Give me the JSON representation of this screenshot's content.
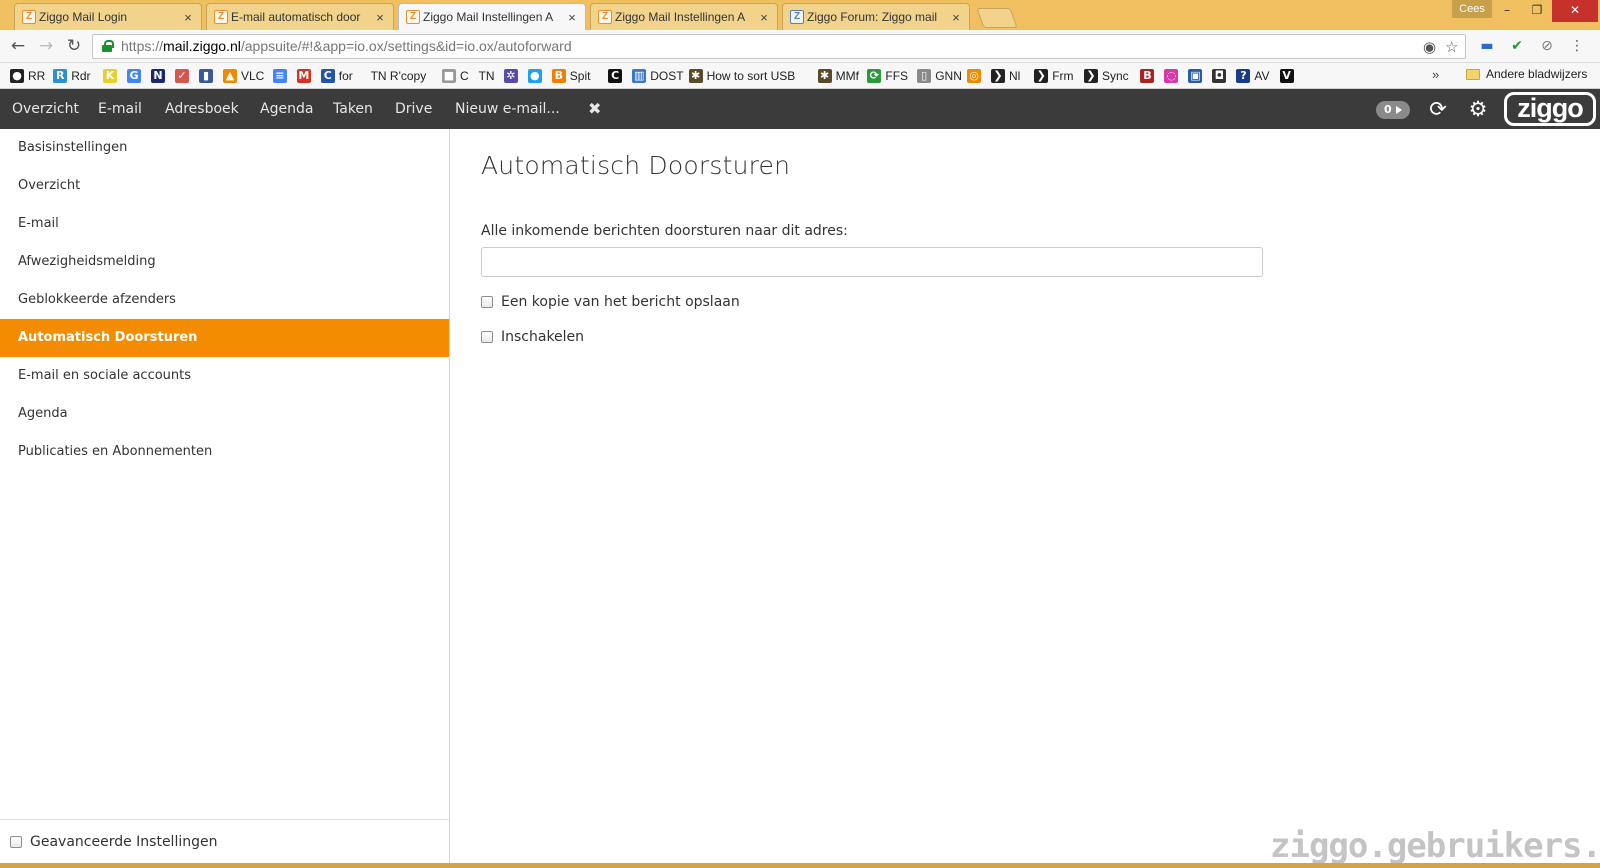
{
  "browser": {
    "tabs": [
      {
        "title": "Ziggo Mail Login",
        "favicon": "ziggo-icon"
      },
      {
        "title": "E-mail automatisch door",
        "favicon": "ziggo-icon"
      },
      {
        "title": "Ziggo Mail Instellingen A",
        "favicon": "ziggo-icon",
        "active": true
      },
      {
        "title": "Ziggo Mail Instellingen A",
        "favicon": "ziggo-icon"
      },
      {
        "title": "Ziggo Forum: Ziggo mail",
        "favicon": "forum-icon"
      }
    ],
    "favicon_letter": "Z",
    "tab_close_glyph": "×",
    "user_name": "Cees",
    "window_controls": {
      "minimize": "–",
      "restore": "❐",
      "close": "✕"
    },
    "nav": {
      "back": "←",
      "forward": "→",
      "reload": "↻"
    },
    "url": {
      "scheme": "https://",
      "domain": "mail.ziggo.nl",
      "path": "/appsuite/#!&app=io.ox/settings&id=io.ox/autoforward"
    },
    "omnibox_icons": {
      "eye": "◉",
      "star": "☆"
    },
    "extension_icons": [
      "▬",
      "✔",
      "⊘",
      "⋮"
    ],
    "bookmarks": [
      {
        "label": "RR",
        "icon_text": "●",
        "color": "#222222"
      },
      {
        "label": "Rdr",
        "icon_text": "R",
        "color": "#2a8fd4"
      },
      {
        "label": "",
        "icon_text": "K",
        "color": "#e8d02a"
      },
      {
        "label": "",
        "icon_text": "G",
        "color": "#4285f4"
      },
      {
        "label": "",
        "icon_text": "N",
        "color": "#1a2a6c"
      },
      {
        "label": "",
        "icon_text": "✓",
        "color": "#d9534f"
      },
      {
        "label": "",
        "icon_text": "▮",
        "color": "#3b5998"
      },
      {
        "label": "VLC",
        "icon_text": "▲",
        "color": "#f08a00"
      },
      {
        "label": "",
        "icon_text": "≡",
        "color": "#4285f4"
      },
      {
        "label": "",
        "icon_text": "M",
        "color": "#d93025"
      },
      {
        "label": "for",
        "icon_text": "C",
        "color": "#2255aa"
      },
      {
        "label": "TN R'copy",
        "icon_text": "",
        "color": "#f7f7f7"
      },
      {
        "label": "C",
        "icon_text": "■",
        "color": "#9a9a9a"
      },
      {
        "label": "TN",
        "icon_text": "",
        "color": "#f7f7f7"
      },
      {
        "label": "",
        "icon_text": "✲",
        "color": "#5b4aa8"
      },
      {
        "label": "",
        "icon_text": "●",
        "color": "#1da1f2"
      },
      {
        "label": "Spit",
        "icon_text": "B",
        "color": "#f57d00"
      },
      {
        "label": "",
        "icon_text": "C",
        "color": "#111111"
      },
      {
        "label": "DOST",
        "icon_text": "▥",
        "color": "#3a78c9"
      },
      {
        "label": "How to sort USB",
        "icon_text": "✱",
        "color": "#5a4a2a"
      },
      {
        "label": "MMf",
        "icon_text": "✱",
        "color": "#5a4a2a"
      },
      {
        "label": "FFS",
        "icon_text": "⟳",
        "color": "#2a9a3a"
      },
      {
        "label": "GNN",
        "icon_text": "▯",
        "color": "#8a8a8a"
      },
      {
        "label": "",
        "icon_text": "◎",
        "color": "#f08a00"
      },
      {
        "label": "Nl",
        "icon_text": "❯",
        "color": "#222222"
      },
      {
        "label": "Frm",
        "icon_text": "❯",
        "color": "#222222"
      },
      {
        "label": "Sync",
        "icon_text": "❯",
        "color": "#222222"
      },
      {
        "label": "",
        "icon_text": "B",
        "color": "#aa2222"
      },
      {
        "label": "",
        "icon_text": "◌",
        "color": "#d63aa8"
      },
      {
        "label": "",
        "icon_text": "▣",
        "color": "#2a5aa8"
      },
      {
        "label": "",
        "icon_text": "◘",
        "color": "#333333"
      },
      {
        "label": "AV",
        "icon_text": "?",
        "color": "#1a3a8a"
      },
      {
        "label": "",
        "icon_text": "V",
        "color": "#111111"
      }
    ],
    "bookmarks_more": "»",
    "other_bookmarks": "Andere bladwijzers"
  },
  "app": {
    "nav_items": [
      "Overzicht",
      "E-mail",
      "Adresboek",
      "Agenda",
      "Taken",
      "Drive",
      "Nieuw e-mail..."
    ],
    "nav_close": "✖",
    "notification_count": "0",
    "refresh_glyph": "⟳",
    "settings_glyph": "⚙",
    "logo_text": "ziggo"
  },
  "sidebar": {
    "items": [
      "Basisinstellingen",
      "Overzicht",
      "E-mail",
      "Afwezigheidsmelding",
      "Geblokkeerde afzenders",
      "Automatisch Doorsturen",
      "E-mail en sociale accounts",
      "Agenda",
      "Publicaties en Abonnementen"
    ],
    "active_item": "Automatisch Doorsturen",
    "advanced_label": "Geavanceerde Instellingen"
  },
  "main": {
    "title": "Automatisch Doorsturen",
    "forward_label": "Alle inkomende berichten doorsturen naar dit adres:",
    "forward_value": "",
    "copy_label": "Een kopie van het bericht opslaan",
    "enable_label": "Inschakelen"
  },
  "watermark": "ziggo.gebruikers.eu",
  "colors": {
    "accent": "#f38c00",
    "nav_bg": "#3b3b3b",
    "tabstrip": "#f0c060"
  }
}
